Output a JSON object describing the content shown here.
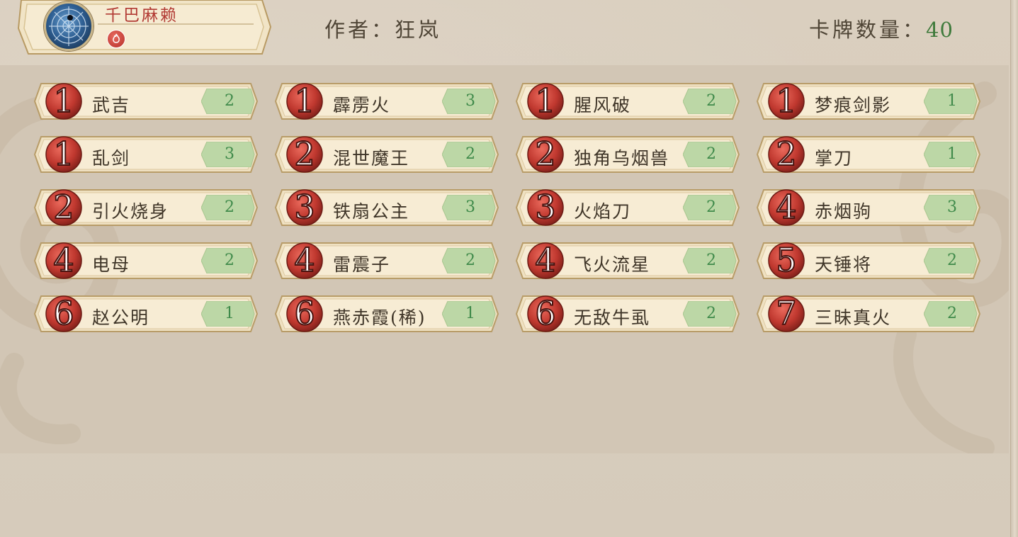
{
  "header": {
    "deck_name": "千巴麻赖",
    "author_label": "作者：狂岚",
    "card_count_label": "卡牌数量：",
    "card_count_value": "40",
    "avatar_icon": "spider-web-icon",
    "element_icon": "fire-element-icon"
  },
  "colors": {
    "cost_orb": "#c0382f",
    "copies_badge": "#b9d6a4",
    "card_plate": "#f5e9cd",
    "deck_name": "#b23b34",
    "count_value": "#3e7a3b"
  },
  "cards": [
    {
      "cost": "1",
      "name": "武吉",
      "copies": "2"
    },
    {
      "cost": "1",
      "name": "霹雳火",
      "copies": "3"
    },
    {
      "cost": "1",
      "name": "腥风破",
      "copies": "2"
    },
    {
      "cost": "1",
      "name": "梦痕剑影",
      "copies": "1"
    },
    {
      "cost": "1",
      "name": "乱剑",
      "copies": "3"
    },
    {
      "cost": "2",
      "name": "混世魔王",
      "copies": "2"
    },
    {
      "cost": "2",
      "name": "独角乌烟兽",
      "copies": "2"
    },
    {
      "cost": "2",
      "name": "掌刀",
      "copies": "1"
    },
    {
      "cost": "2",
      "name": "引火烧身",
      "copies": "2"
    },
    {
      "cost": "3",
      "name": "铁扇公主",
      "copies": "3"
    },
    {
      "cost": "3",
      "name": "火焰刀",
      "copies": "2"
    },
    {
      "cost": "4",
      "name": "赤烟驹",
      "copies": "3"
    },
    {
      "cost": "4",
      "name": "电母",
      "copies": "2"
    },
    {
      "cost": "4",
      "name": "雷震子",
      "copies": "2"
    },
    {
      "cost": "4",
      "name": "飞火流星",
      "copies": "2"
    },
    {
      "cost": "5",
      "name": "天锤将",
      "copies": "2"
    },
    {
      "cost": "6",
      "name": "赵公明",
      "copies": "1"
    },
    {
      "cost": "6",
      "name": "燕赤霞(稀)",
      "copies": "1"
    },
    {
      "cost": "6",
      "name": "无敌牛虱",
      "copies": "2"
    },
    {
      "cost": "7",
      "name": "三昧真火",
      "copies": "2"
    }
  ]
}
